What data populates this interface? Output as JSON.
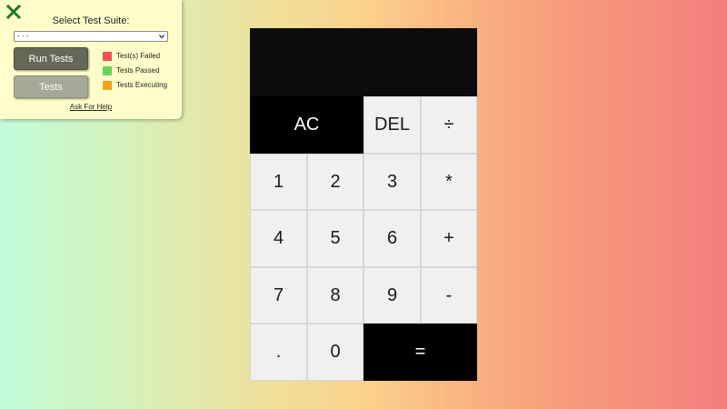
{
  "panel": {
    "title": "Select Test Suite:",
    "suite_select": {
      "selected": "- - -"
    },
    "run_button": "Run Tests",
    "tests_button": "Tests",
    "legend": [
      {
        "label": "Test(s) Failed",
        "color": "#f0524a"
      },
      {
        "label": "Tests Passed",
        "color": "#67d458"
      },
      {
        "label": "Tests Executing",
        "color": "#f2a31c"
      }
    ],
    "help_link": "Ask For Help",
    "close_icon": "close-x-icon",
    "colors": {
      "background": "#fffecb",
      "close_icon": "#1f7a1f",
      "run_button": "#676759",
      "tests_button": "#a8a896"
    }
  },
  "calculator": {
    "display": "",
    "keys": {
      "clear": "AC",
      "delete": "DEL",
      "divide": "÷",
      "multiply": "*",
      "add": "+",
      "subtract": "-",
      "decimal": ".",
      "equals": "=",
      "one": "1",
      "two": "2",
      "three": "3",
      "four": "4",
      "five": "5",
      "six": "6",
      "seven": "7",
      "eight": "8",
      "nine": "9",
      "zero": "0"
    },
    "colors": {
      "display": "#0c0c0c",
      "dark_key": "#000000",
      "light_key": "#f0f0f0"
    }
  }
}
